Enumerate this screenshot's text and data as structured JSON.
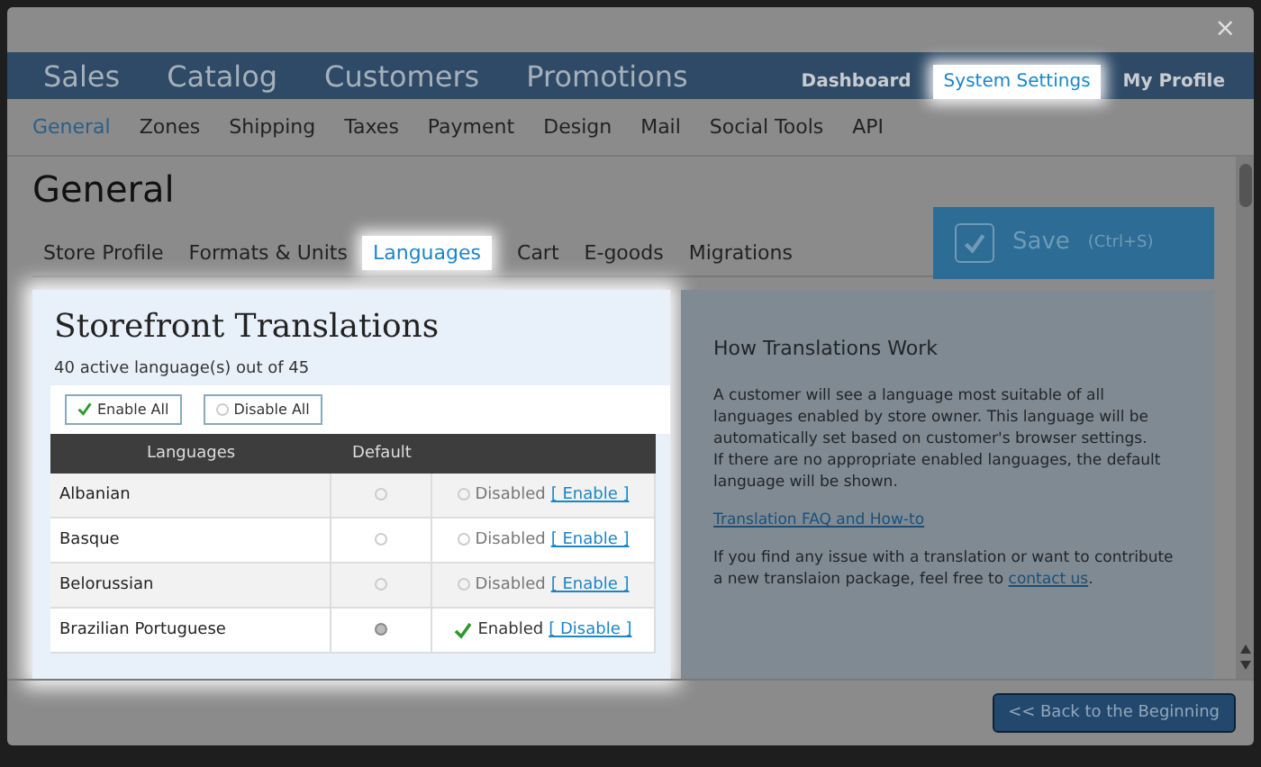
{
  "window": {
    "close": "×"
  },
  "main_nav": [
    {
      "label": "Sales"
    },
    {
      "label": "Catalog"
    },
    {
      "label": "Customers"
    },
    {
      "label": "Promotions"
    }
  ],
  "user_nav": [
    {
      "label": "Dashboard",
      "selected": false
    },
    {
      "label": "System Settings",
      "selected": true
    },
    {
      "label": "My Profile",
      "selected": false
    }
  ],
  "sub_nav": [
    {
      "label": "General",
      "selected": true
    },
    {
      "label": "Zones",
      "selected": false
    },
    {
      "label": "Shipping",
      "selected": false
    },
    {
      "label": "Taxes",
      "selected": false
    },
    {
      "label": "Payment",
      "selected": false
    },
    {
      "label": "Design",
      "selected": false
    },
    {
      "label": "Mail",
      "selected": false
    },
    {
      "label": "Social Tools",
      "selected": false
    },
    {
      "label": "API",
      "selected": false
    }
  ],
  "page_title": "General",
  "tabs": [
    {
      "label": "Store Profile",
      "selected": false
    },
    {
      "label": "Formats & Units",
      "selected": false
    },
    {
      "label": "Languages",
      "selected": true
    },
    {
      "label": "Cart",
      "selected": false
    },
    {
      "label": "E-goods",
      "selected": false
    },
    {
      "label": "Migrations",
      "selected": false
    }
  ],
  "save_button": {
    "label": "Save",
    "shortcut": "(Ctrl+S)"
  },
  "translations": {
    "title": "Storefront Translations",
    "count": "40 active language(s) out of 45",
    "buttons": [
      {
        "kind": "enable",
        "label": "Enable All"
      },
      {
        "kind": "disable",
        "label": "Disable All"
      }
    ],
    "columns": [
      "Languages",
      "Default"
    ],
    "rows": [
      {
        "language": "Albanian",
        "default": false,
        "enabled": false,
        "status": "Disabled",
        "action": "[ Enable ]"
      },
      {
        "language": "Basque",
        "default": false,
        "enabled": false,
        "status": "Disabled",
        "action": "[ Enable ]"
      },
      {
        "language": "Belorussian",
        "default": false,
        "enabled": false,
        "status": "Disabled",
        "action": "[ Enable ]"
      },
      {
        "language": "Brazilian Portuguese",
        "default": true,
        "enabled": true,
        "status": "Enabled",
        "action": "[ Disable ]"
      }
    ]
  },
  "help": {
    "title": "How Translations Work",
    "paragraph_1": "A customer will see a language most suitable of all languages enabled by store owner. This language will be automatically set based on customer's browser settings.",
    "paragraph_2": "If there are no appropriate enabled languages, the default language will be shown.",
    "link": "Translation FAQ and How-to",
    "paragraph_3": "If you find any issue with a translation or want to contribute a new translaion package, feel free to",
    "contact_link": "contact us",
    "paragraph_3_end": "."
  },
  "footer_button": "<< Back to the Beginning"
}
